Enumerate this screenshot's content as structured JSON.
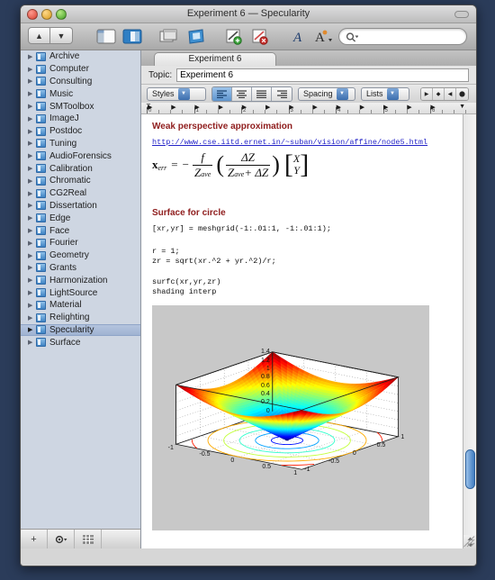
{
  "window": {
    "title": "Experiment 6 — Specularity",
    "traffic_lights": [
      "close",
      "minimize",
      "zoom"
    ]
  },
  "toolbar": {
    "prev_label": "▲",
    "next_label": "▼",
    "icons": [
      {
        "name": "sidebar-toggle-icon",
        "label": "sidebar"
      },
      {
        "name": "panes-toggle-icon",
        "label": "panes"
      },
      {
        "name": "windows-icon",
        "label": "windows"
      },
      {
        "name": "notebook-icon",
        "label": "notebook"
      },
      {
        "name": "add-link-icon",
        "label": "add link"
      },
      {
        "name": "remove-link-icon",
        "label": "remove link"
      },
      {
        "name": "font-icon",
        "label": "A"
      },
      {
        "name": "text-style-icon",
        "label": "A"
      },
      {
        "name": "colors-icon",
        "label": "colors"
      }
    ],
    "search_placeholder": ""
  },
  "sidebar": {
    "items": [
      "Archive",
      "Computer",
      "Consulting",
      "Music",
      "SMToolbox",
      "ImageJ",
      "Postdoc",
      "Tuning",
      "AudioForensics",
      "Calibration",
      "Chromatic",
      "CG2Real",
      "Dissertation",
      "Edge",
      "Face",
      "Fourier",
      "Geometry",
      "Grants",
      "Harmonization",
      "LightSource",
      "Material",
      "Relighting",
      "Specularity",
      "Surface"
    ],
    "selected": "Specularity",
    "bottom_buttons": [
      {
        "name": "add-notebook-button",
        "label": "+"
      },
      {
        "name": "action-gear-button",
        "label": "✳"
      },
      {
        "name": "view-grid-button",
        "label": "▦"
      }
    ]
  },
  "editor": {
    "tab_label": "Experiment 6",
    "topic_label": "Topic:",
    "topic_value": "Experiment 6",
    "format": {
      "styles_label": "Styles",
      "spacing_label": "Spacing",
      "lists_label": "Lists",
      "align_buttons": [
        "align-left",
        "align-center",
        "align-justify",
        "align-right"
      ],
      "align_selected": "align-left",
      "nav_buttons": [
        "play",
        "diamond",
        "back",
        "record"
      ]
    },
    "ruler_numbers": [
      "0",
      "1",
      "2",
      "3",
      "4",
      "5",
      "6",
      "7"
    ]
  },
  "document": {
    "heading1": "Weak perspective approximation",
    "link": "http://www.cse.iitd.ernet.in/~suban/vision/affine/node5.html",
    "formula": {
      "lhs_base": "x",
      "lhs_sub": "err",
      "equals": "=",
      "minus": "−",
      "frac1_num": "f",
      "frac1_den_base": "Z",
      "frac1_den_sub": "ave",
      "frac2_num": "ΔZ",
      "frac2_den": "Z",
      "frac2_den_sub": "ave",
      "frac2_den_tail": "+ ΔZ",
      "vec_top": "X",
      "vec_bottom": "Y"
    },
    "heading2": "Surface for circle",
    "code_block1": "[xr,yr] = meshgrid(-1:.01:1, -1:.01:1);",
    "code_block2": "r = 1;\nzr = sqrt(xr.^2 + yr.^2)/r;",
    "code_block3": "surfc(xr,yr,zr)\nshading interp"
  },
  "chart_data": {
    "type": "surface",
    "title": "",
    "xlabel": "",
    "ylabel": "",
    "zlabel": "",
    "function": "z = sqrt(x^2 + y^2) / r,  r = 1",
    "xlim": [
      -1,
      1
    ],
    "ylim": [
      -1,
      1
    ],
    "zlim": [
      0,
      1.4142
    ],
    "x_ticks": [
      "-1",
      "-0.5",
      "0",
      "0.5",
      "1"
    ],
    "y_ticks": [
      "-1",
      "-0.5",
      "0",
      "0.5",
      "1"
    ],
    "z_ticks": [
      "0",
      "0.2",
      "0.4",
      "0.6",
      "0.8",
      "1",
      "1.2",
      "1.4"
    ],
    "colormap": "jet",
    "shading": "interp",
    "contours_at_base": true,
    "contour_levels": [
      0.2,
      0.4,
      0.6,
      0.8,
      1.0,
      1.2,
      1.4
    ],
    "grid": true,
    "background": "#c8c8c8",
    "axes_background": "#ffffff",
    "legend": "none",
    "description": "MATLAB surfc cone surface: low (blue) at centre, high (red) at corners, with filled jet colormap and coloured contour lines projected on the base plane"
  }
}
